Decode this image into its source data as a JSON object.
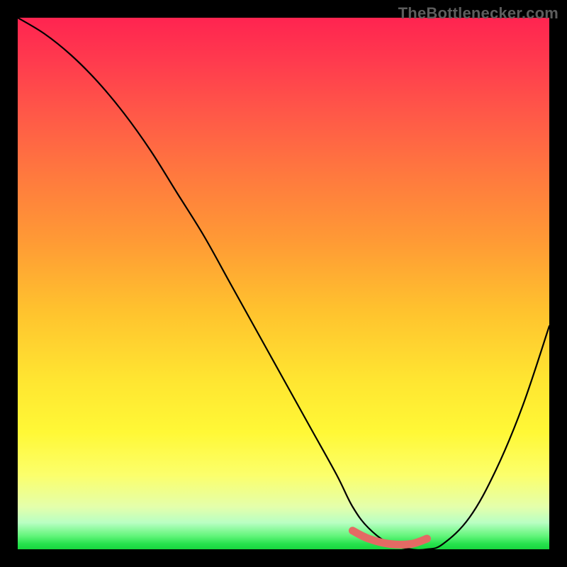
{
  "attribution": "TheBottlenecker.com",
  "chart_data": {
    "type": "line",
    "title": "",
    "xlabel": "",
    "ylabel": "",
    "xlim": [
      0,
      100
    ],
    "ylim": [
      0,
      100
    ],
    "series": [
      {
        "name": "bottleneck-curve",
        "x": [
          0,
          5,
          10,
          15,
          20,
          25,
          30,
          35,
          40,
          45,
          50,
          55,
          60,
          63,
          66,
          70,
          74,
          77,
          80,
          85,
          90,
          95,
          100
        ],
        "y": [
          100,
          97,
          93,
          88,
          82,
          75,
          67,
          59,
          50,
          41,
          32,
          23,
          14,
          8,
          4,
          1,
          0,
          0,
          1,
          6,
          15,
          27,
          42
        ]
      }
    ],
    "highlight": {
      "name": "optimal-range",
      "x": [
        63,
        66,
        70,
        74,
        77
      ],
      "y": [
        3.5,
        2.0,
        1.0,
        1.0,
        2.0
      ],
      "color": "#e46a64"
    },
    "background_gradient_stops": [
      {
        "pos": 0.0,
        "color": "#ff2450"
      },
      {
        "pos": 0.3,
        "color": "#ff7a3e"
      },
      {
        "pos": 0.68,
        "color": "#ffe531"
      },
      {
        "pos": 0.93,
        "color": "#b9ffc3"
      },
      {
        "pos": 1.0,
        "color": "#18d63e"
      }
    ]
  }
}
